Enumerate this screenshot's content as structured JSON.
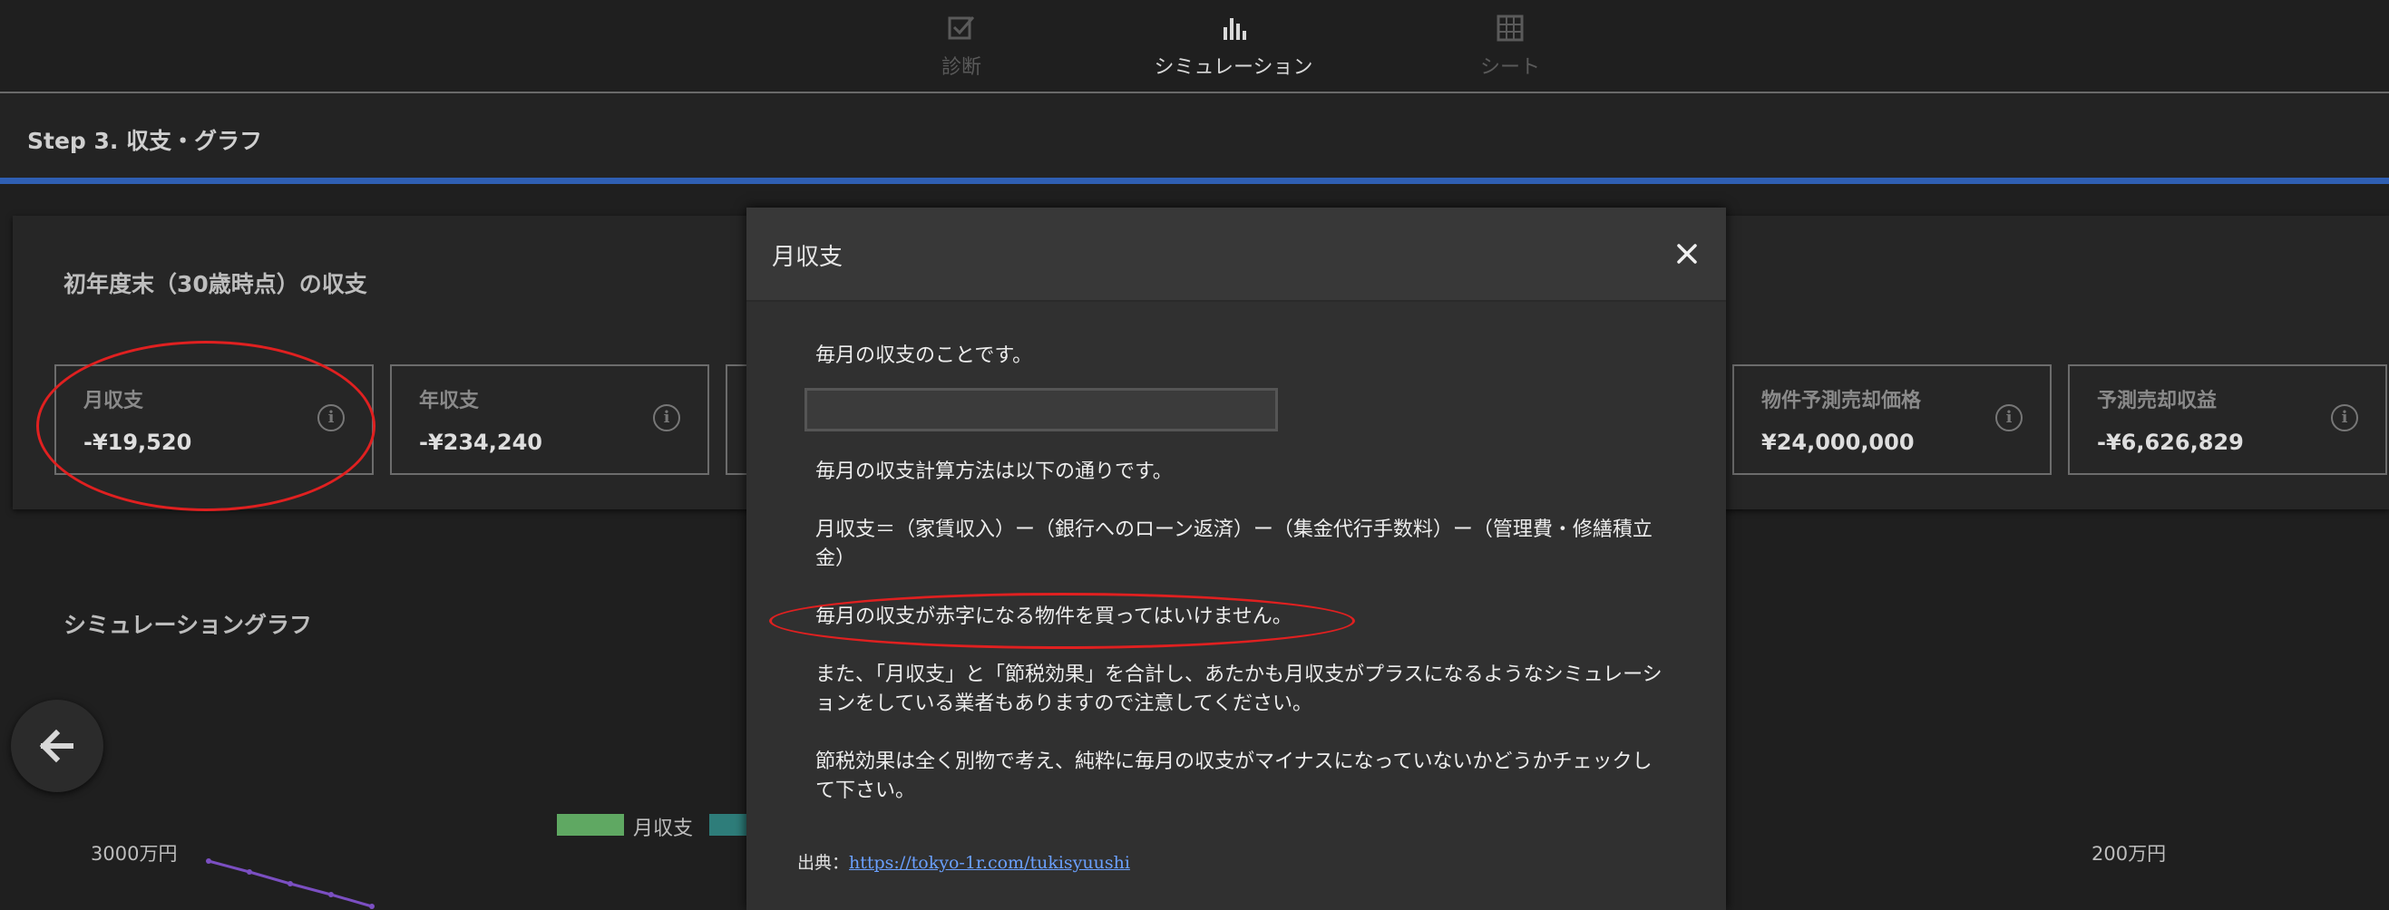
{
  "nav": {
    "items": [
      {
        "label": "診断",
        "icon": "checkbox-icon",
        "active": false
      },
      {
        "label": "シミュレーション",
        "icon": "bar-chart-icon",
        "active": true
      },
      {
        "label": "シート",
        "icon": "grid-icon",
        "active": false
      }
    ]
  },
  "step": {
    "title": "Step 3. 収支・グラフ"
  },
  "summary": {
    "title": "初年度末（30歳時点）の収支",
    "cards": [
      {
        "label": "月収支",
        "value": "-¥19,520"
      },
      {
        "label": "年収支",
        "value": "-¥234,240"
      },
      {
        "label": "物件予測売却価格",
        "value": "¥24,000,000"
      },
      {
        "label": "予測売却収益",
        "value": "-¥6,626,829"
      }
    ]
  },
  "graph": {
    "title": "シミュレーショングラフ",
    "legend_label": "月収支",
    "legend_colors": [
      "#5fa862",
      "#2e7d7a"
    ],
    "axis_left_top": "3000万円",
    "axis_right_top": "200万円"
  },
  "modal": {
    "title": "月収支",
    "close_icon": "close-icon",
    "p1": "毎月の収支のことです。",
    "p2": "毎月の収支計算方法は以下の通りです。",
    "p3": "月収支＝（家賃収入）ー（銀行へのローン返済）ー（集金代行手数料）ー（管理費・修繕積立金）",
    "p4": "毎月の収支が赤字になる物件を買ってはいけません。",
    "p5": "また、「月収支」と「節税効果」を合計し、あたかも月収支がプラスになるようなシミュレーションをしている業者もありますので注意してください。",
    "p6": "節税効果は全く別物で考え、純粋に毎月の収支がマイナスになっていないかどうかチェックして下さい。",
    "source_prefix": "出典：",
    "source_link": "https://tokyo-1r.com/tukisyuushi"
  },
  "colors": {
    "accent_blue": "#2f5fb3",
    "annotation_red": "#e02020",
    "link": "#6aa0ff"
  }
}
